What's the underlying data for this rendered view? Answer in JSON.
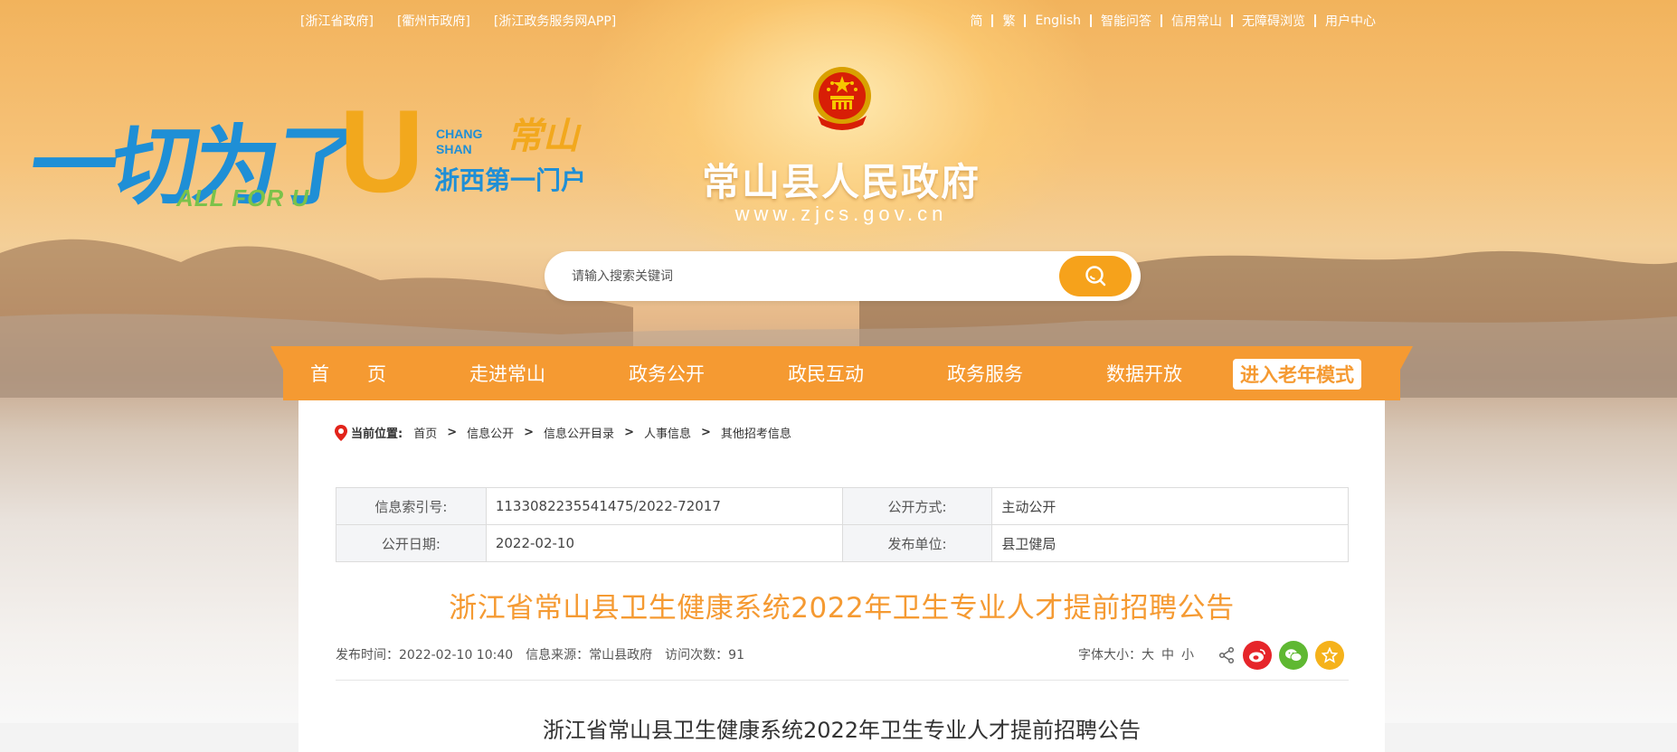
{
  "toplinks_left": [
    "[浙江省政府]",
    "[衢州市政府]",
    "[浙江政务服务网APP]"
  ],
  "toplinks_right": [
    "简",
    "繁",
    "English",
    "智能问答",
    "信用常山",
    "无障碍浏览",
    "用户中心"
  ],
  "slogan": {
    "main": "一切为了",
    "u": "U",
    "sub": "ALL FOR U",
    "cs_en": "CHANG SHAN",
    "cs_cn": "常山",
    "gateway": "浙西第一门户"
  },
  "site": {
    "title": "常山县人民政府",
    "url": "www.zjcs.gov.cn"
  },
  "search": {
    "placeholder": "请输入搜索关键词",
    "icon": "search-icon"
  },
  "nav": {
    "items": [
      "首　　页",
      "走进常山",
      "政务公开",
      "政民互动",
      "政务服务",
      "数据开放"
    ],
    "elder": "进入老年模式"
  },
  "breadcrumb": {
    "label": "当前位置:",
    "items": [
      "首页",
      "信息公开",
      "信息公开目录",
      "人事信息",
      "其他招考信息"
    ]
  },
  "meta": {
    "index_label": "信息索引号:",
    "index_value": "1133082235541475/2022-72017",
    "mode_label": "公开方式:",
    "mode_value": "主动公开",
    "date_label": "公开日期:",
    "date_value": "2022-02-10",
    "unit_label": "发布单位:",
    "unit_value": "县卫健局"
  },
  "article": {
    "title": "浙江省常山县卫生健康系统2022年卫生专业人才提前招聘公告",
    "publish_time": "发布时间：2022-02-10 10:40",
    "source": "信息来源：常山县政府",
    "visits": "访问次数：91",
    "font_size_label": "字体大小：",
    "font_sizes": [
      "大",
      "中",
      "小"
    ],
    "body_title": "浙江省常山县卫生健康系统2022年卫生专业人才提前招聘公告"
  },
  "colors": {
    "accent": "#f59a32",
    "weibo": "#e6252a",
    "wechat": "#5fb832",
    "favorite": "#f5b21b"
  }
}
